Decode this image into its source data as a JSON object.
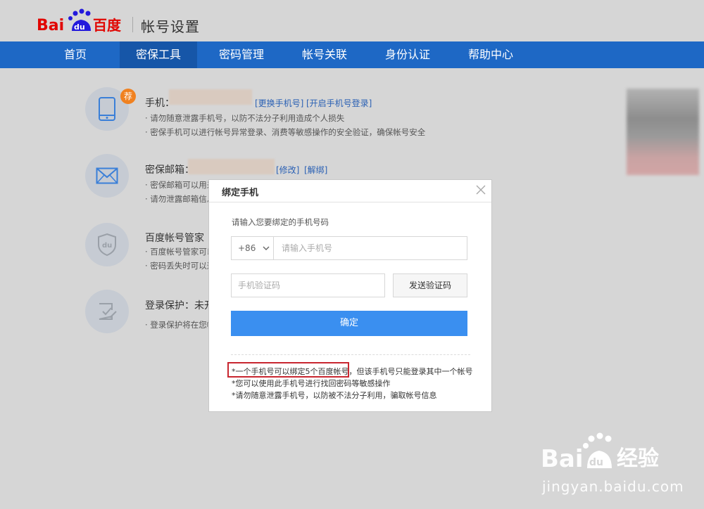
{
  "header": {
    "logo_text": "Bai du 百度",
    "page_title": "帐号设置"
  },
  "nav": {
    "items": [
      {
        "label": "首页"
      },
      {
        "label": "密保工具"
      },
      {
        "label": "密码管理"
      },
      {
        "label": "帐号关联"
      },
      {
        "label": "身份认证"
      },
      {
        "label": "帮助中心"
      }
    ],
    "active_index": 1
  },
  "rows": [
    {
      "title": "手机：",
      "badge": "荐",
      "links": [
        "[更换手机号]",
        "[开启手机号登录]"
      ],
      "desc": [
        "· 请勿随意泄露手机号，以防不法分子利用造成个人损失",
        "· 密保手机可以进行帐号异常登录、消费等敏感操作的安全验证，确保帐号安全"
      ]
    },
    {
      "title": "密保邮箱：",
      "links": [
        "[修改]",
        "[解绑]"
      ],
      "desc": [
        "· 密保邮箱可以用来",
        "· 请勿泄露邮箱信息"
      ]
    },
    {
      "title": "百度帐号管家",
      "desc": [
        "· 百度帐号管家可以",
        "· 密码丢失时可以通"
      ]
    },
    {
      "title": "登录保护：未开",
      "desc": [
        "· 登录保护将在您帐"
      ]
    }
  ],
  "modal": {
    "title": "绑定手机",
    "prompt": "请输入您要绑定的手机号码",
    "country_code": "+86",
    "phone_placeholder": "请输入手机号",
    "code_placeholder": "手机验证码",
    "send_code_label": "发送验证码",
    "confirm_label": "确定",
    "notes": [
      "*一个手机号可以绑定5个百度帐号，但该手机号只能登录其中一个帐号",
      "*您可以使用此手机号进行找回密码等敏感操作",
      "*请勿随意泄露手机号，以防被不法分子利用，骗取帐号信息"
    ]
  },
  "watermark": {
    "brand": "Bai du 经验",
    "url": "jingyan.baidu.com"
  },
  "colors": {
    "nav_bg": "#1e68c5",
    "nav_active": "#1656a8",
    "confirm_btn": "#3a8ff0",
    "badge": "#f08120",
    "highlight_border": "#c8262f",
    "link": "#2b61b4"
  }
}
